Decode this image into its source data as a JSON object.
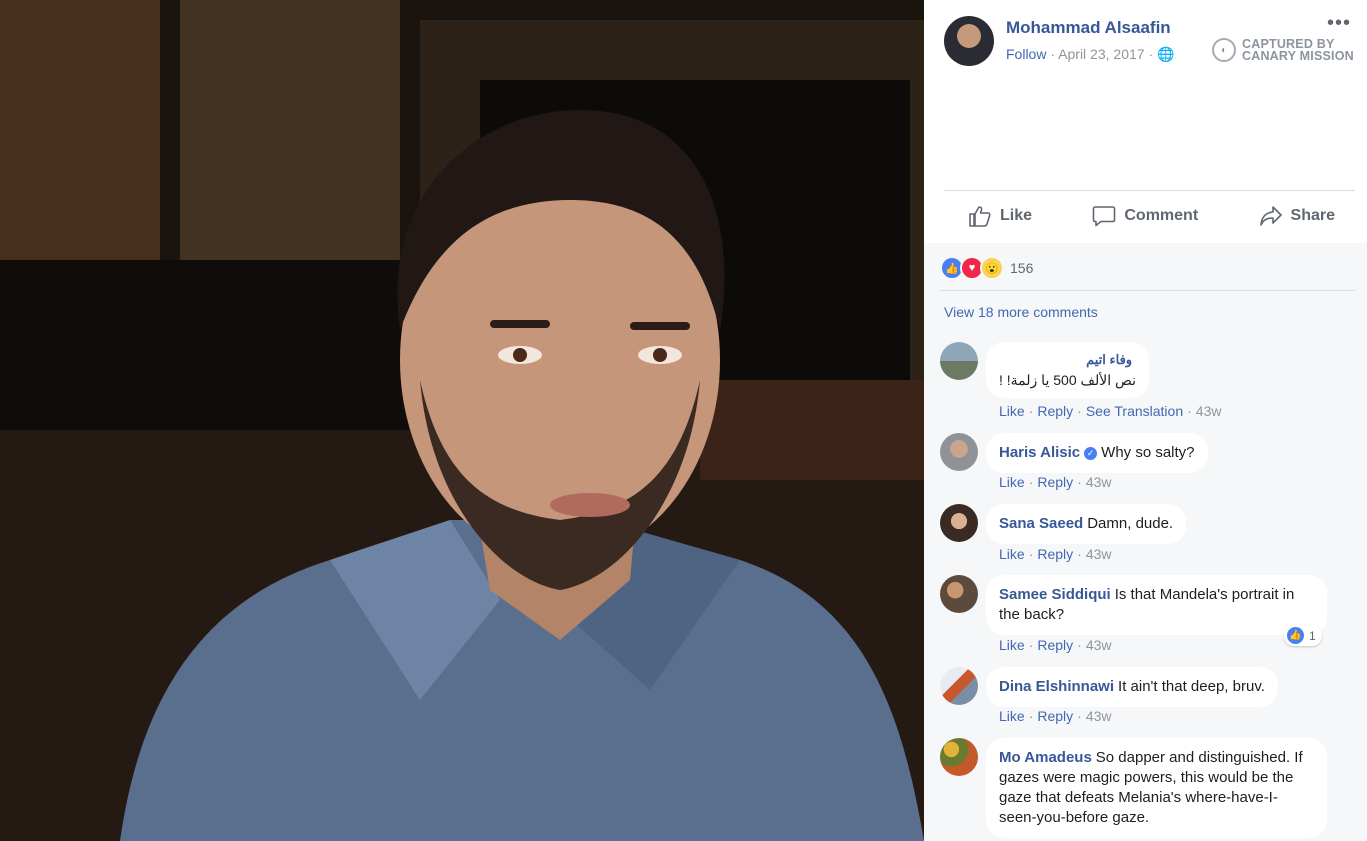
{
  "post": {
    "author": "Mohammad Alsaafin",
    "follow": "Follow",
    "date": "April 23, 2017",
    "sep": "·",
    "more_icon": "more-options-icon",
    "watermark_line1": "CAPTURED BY",
    "watermark_line2": "CANARY MISSION"
  },
  "actions": {
    "like": "Like",
    "comment": "Comment",
    "share": "Share"
  },
  "reactions": {
    "count": "156",
    "types": [
      "like",
      "love",
      "wow"
    ]
  },
  "view_more": "View 18 more comments",
  "comments": [
    {
      "name": "وفاء اتيم",
      "text": "نص الألف 500 يا زلمة! !",
      "links": [
        "Like",
        "Reply",
        "See Translation"
      ],
      "time": "43w"
    },
    {
      "name": "Haris Alisic",
      "text": "Why so salty?",
      "verified": true,
      "links": [
        "Like",
        "Reply"
      ],
      "time": "43w"
    },
    {
      "name": "Sana Saeed",
      "text": "Damn, dude.",
      "links": [
        "Like",
        "Reply"
      ],
      "time": "43w"
    },
    {
      "name": "Samee Siddiqui",
      "text": "Is that Mandela's portrait in the back?",
      "links": [
        "Like",
        "Reply"
      ],
      "time": "43w",
      "likes": "1"
    },
    {
      "name": "Dina Elshinnawi",
      "text": "It ain't that deep, bruv.",
      "links": [
        "Like",
        "Reply"
      ],
      "time": "43w"
    },
    {
      "name": "Mo Amadeus",
      "text": "So dapper and distinguished. If gazes were magic powers, this would be the gaze that defeats Melania's where-have-I-seen-you-before gaze."
    }
  ],
  "colors": {
    "link": "#4267b2",
    "name": "#385898",
    "muted": "#90949c",
    "panel_bg": "#f6f7f9"
  }
}
